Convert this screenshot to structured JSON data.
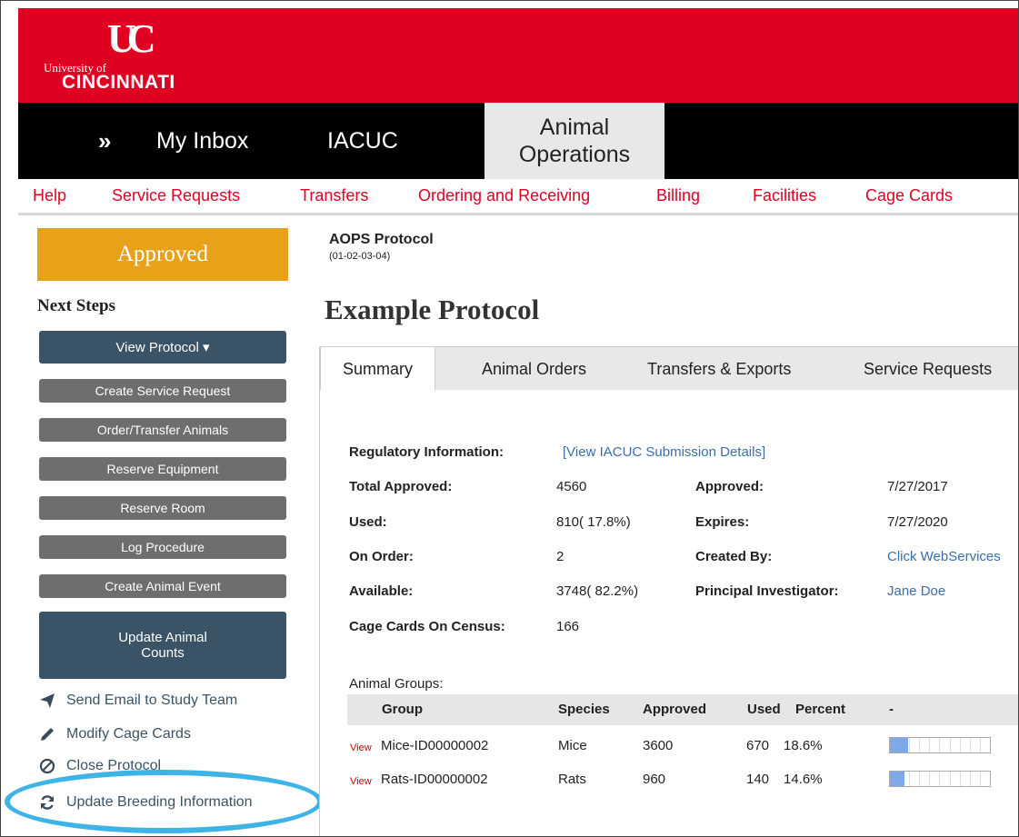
{
  "header": {
    "logo_top": "UC",
    "logo_university_of": "University of",
    "logo_cincinnati": "CINCINNATI",
    "nav": {
      "expand_glyph": "»",
      "my_inbox": "My Inbox",
      "iacuc": "IACUC",
      "animal_operations_line1": "Animal",
      "animal_operations_line2": "Operations"
    },
    "subnav": [
      "Help",
      "Service Requests",
      "Transfers",
      "Ordering and Receiving",
      "Billing",
      "Facilities",
      "Cage Cards"
    ]
  },
  "sidebar": {
    "status": "Approved",
    "next_steps_title": "Next Steps",
    "view_protocol": "View Protocol ▾",
    "actions": [
      "Create Service Request",
      "Order/Transfer Animals",
      "Reserve Equipment",
      "Reserve Room",
      "Log Procedure",
      "Create Animal Event"
    ],
    "update_counts_line1": "Update Animal",
    "update_counts_line2": "Counts",
    "links": {
      "send_email": "Send Email to Study Team",
      "modify_cage_cards": "Modify Cage Cards",
      "close_protocol": "Close Protocol",
      "update_breeding": "Update Breeding Information"
    }
  },
  "main": {
    "protocol_label": "AOPS Protocol",
    "protocol_id": "(01-02-03-04)",
    "title": "Example Protocol",
    "tabs": [
      "Summary",
      "Animal Orders",
      "Transfers & Exports",
      "Service Requests"
    ],
    "summary": {
      "regulatory_label": "Regulatory Information:",
      "regulatory_link": "[View IACUC Submission Details]",
      "total_approved_label": "Total Approved:",
      "total_approved": "4560",
      "used_label": "Used:",
      "used": "810( 17.8%)",
      "on_order_label": "On Order:",
      "on_order": "2",
      "available_label": "Available:",
      "available": "3748( 82.2%)",
      "cage_cards_label": "Cage Cards On Census:",
      "cage_cards": "166",
      "approved_label": "Approved:",
      "approved": "7/27/2017",
      "expires_label": "Expires:",
      "expires": "7/27/2020",
      "created_by_label": "Created By:",
      "created_by": "Click WebServices",
      "pi_label": "Principal Investigator:",
      "pi": "Jane Doe"
    },
    "groups": {
      "caption": "Animal Groups:",
      "headers": [
        "Group",
        "Species",
        "Approved",
        "Used",
        "Percent",
        "-"
      ],
      "rows": [
        {
          "view": "View",
          "group": "Mice-ID00000002",
          "species": "Mice",
          "approved": "3600",
          "used": "670",
          "percent": "18.6%",
          "fraction": 0.186
        },
        {
          "view": "View",
          "group": "Rats-ID00000002",
          "species": "Rats",
          "approved": "960",
          "used": "140",
          "percent": "14.6%",
          "fraction": 0.146
        }
      ]
    }
  },
  "colors": {
    "brand_red": "#e00122",
    "status_orange": "#e8a21a",
    "button_dark": "#3a5366",
    "button_grey": "#6e6e6e",
    "highlight_circle": "#3eb3e6"
  }
}
